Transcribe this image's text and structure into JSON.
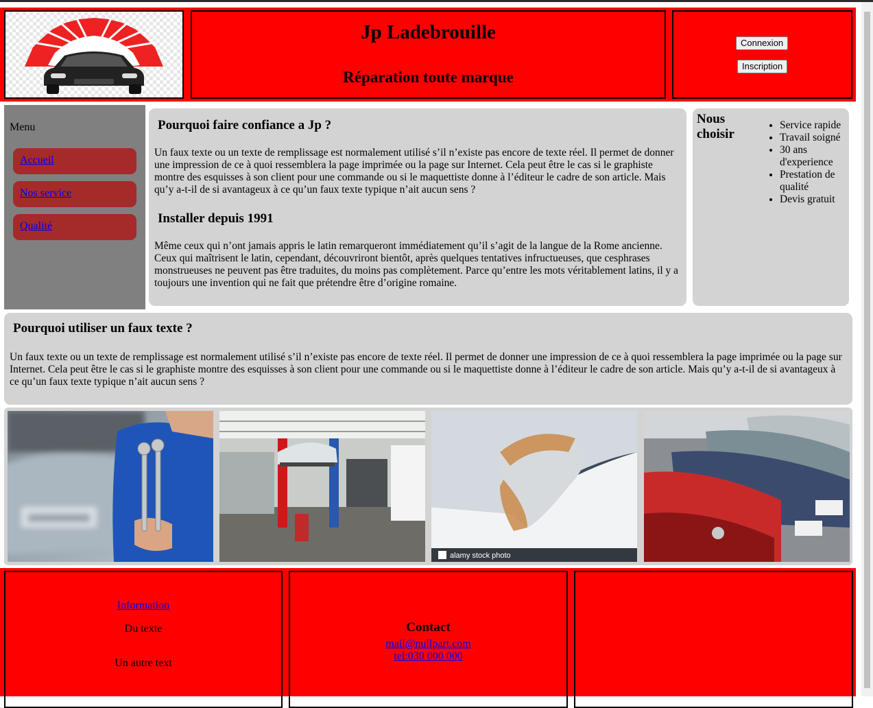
{
  "header": {
    "title": "Jp Ladebrouille",
    "subtitle": "Réparation toute marque",
    "connexion_label": "Connexion",
    "inscription_label": "Inscription"
  },
  "sidebar": {
    "menu_label": "Menu",
    "items": [
      {
        "label": "Accueil"
      },
      {
        "label": "Nos service"
      },
      {
        "label": "Qualité"
      }
    ]
  },
  "main": {
    "heading1": "Pourquoi faire confiance a Jp ?",
    "para1": "Un faux texte ou un texte de remplissage est normalement utilisé s’il n’existe pas encore de texte réel. Il permet de donner une impression de ce à quoi ressemblera la page imprimée ou la page sur Internet. Cela peut être le cas si le graphiste montre des esquisses à son client pour une commande ou si le maquettiste donne à l’éditeur le cadre de son article. Mais qu’y a-t-il de si avantageux à ce qu’un faux texte typique n’ait aucun sens ?",
    "heading2": "Installer depuis 1991",
    "para2": "Même ceux qui n’ont jamais appris le latin remarqueront immédiatement qu’il s’agit de la langue de la Rome ancienne. Ceux qui maîtrisent le latin, cependant, découvriront bientôt, après quelques tentatives infructueuses, que cesphrases monstrueuses ne peuvent pas être traduites, du moins pas complètement. Parce qu’entre les mots véritablement latins, il y a toujours une invention qui ne fait que prétendre être d’origine romaine."
  },
  "aside": {
    "title": "Nous choisir",
    "items": [
      "Service rapide",
      "Travail soigné",
      "30 ans d'experience",
      "Prestation de qualité",
      "Devis gratuit"
    ]
  },
  "section": {
    "heading": "Pourquoi utiliser un faux texte ?",
    "para": "Un faux texte ou un texte de remplissage est normalement utilisé s’il n’existe pas encore de texte réel. Il permet de donner une impression de ce à quoi ressemblera la page imprimée ou la page sur Internet. Cela peut être le cas si le graphiste montre des esquisses à son client pour une commande ou si le maquettiste donne à l’éditeur le cadre de son article. Mais qu’y a-t-il de si avantageux à ce qu’un faux texte typique n’ait aucun sens ?"
  },
  "gallery": {
    "watermark": "alamy stock photo"
  },
  "footer": {
    "info_link": "Information",
    "text1": "Du texte",
    "text2": "Un autre text",
    "contact_title": "Contact",
    "mail": "mail@nullpart.com",
    "tel": "tel:030 000 000"
  },
  "colors": {
    "header_bg": "#ff0000",
    "sidebar_bg": "#808080",
    "nav_item_bg": "#a52a2a",
    "panel_bg": "#d3d3d3",
    "link": "#0000ee"
  }
}
